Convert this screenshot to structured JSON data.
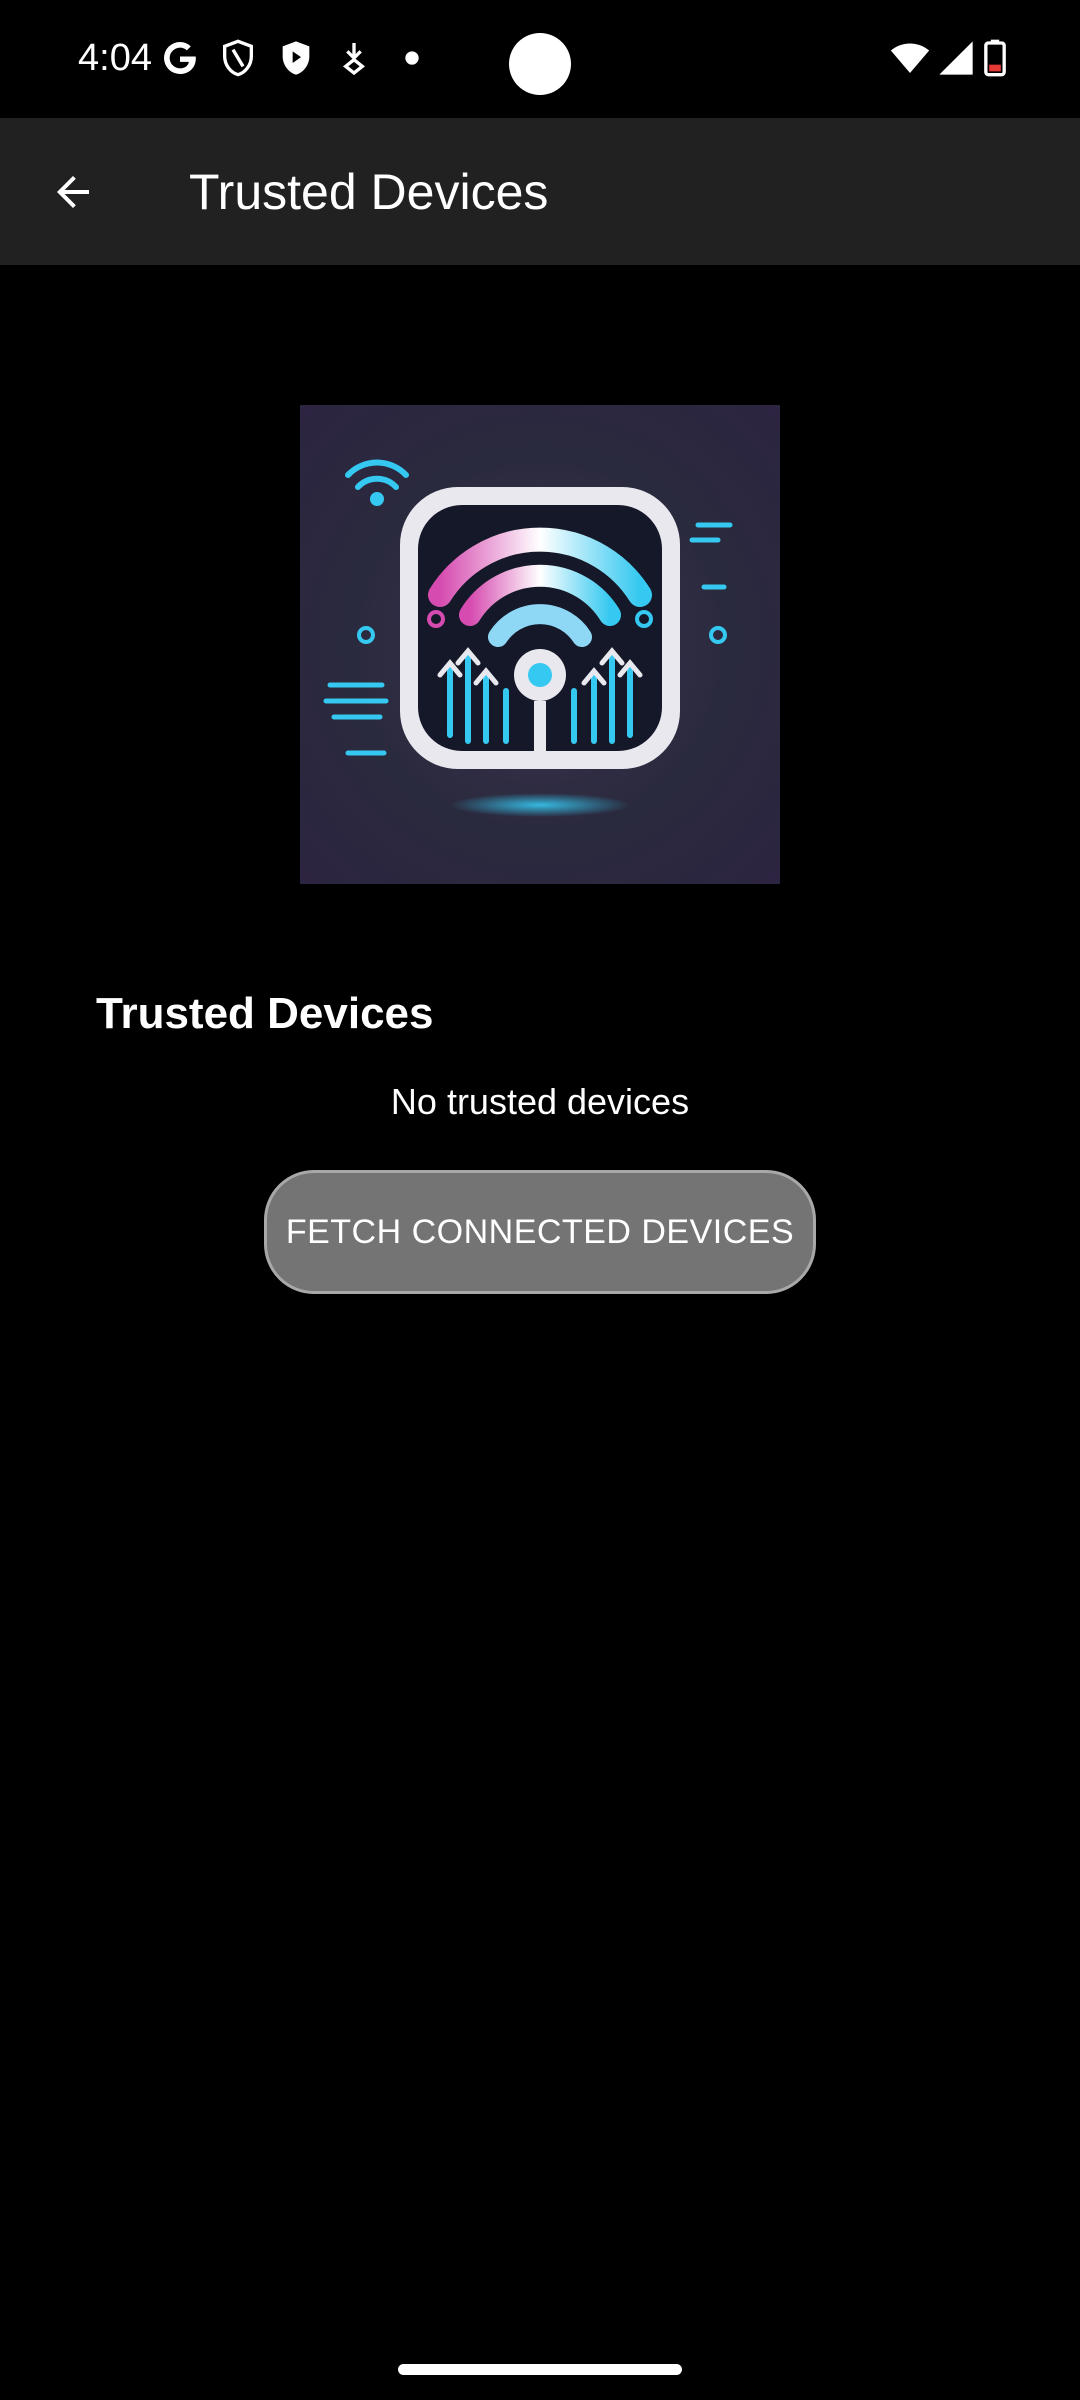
{
  "status_bar": {
    "time": "4:04",
    "icons": [
      "google-icon",
      "shield-outline-icon",
      "shield-filled-icon",
      "download-icon",
      "dot-icon",
      "wifi-icon",
      "signal-icon",
      "battery-icon"
    ]
  },
  "app_bar": {
    "title": "Trusted Devices",
    "back_icon": "arrow-left-icon"
  },
  "hero": {
    "image": "wifi-security-app-logo"
  },
  "section": {
    "title": "Trusted Devices",
    "empty_message": "No trusted devices",
    "fetch_button_label": "FETCH CONNECTED DEVICES"
  },
  "colors": {
    "background": "#000000",
    "app_bar": "#212121",
    "button": "#747474",
    "accent_cyan": "#35c8f0",
    "accent_magenta": "#d64bb0"
  }
}
